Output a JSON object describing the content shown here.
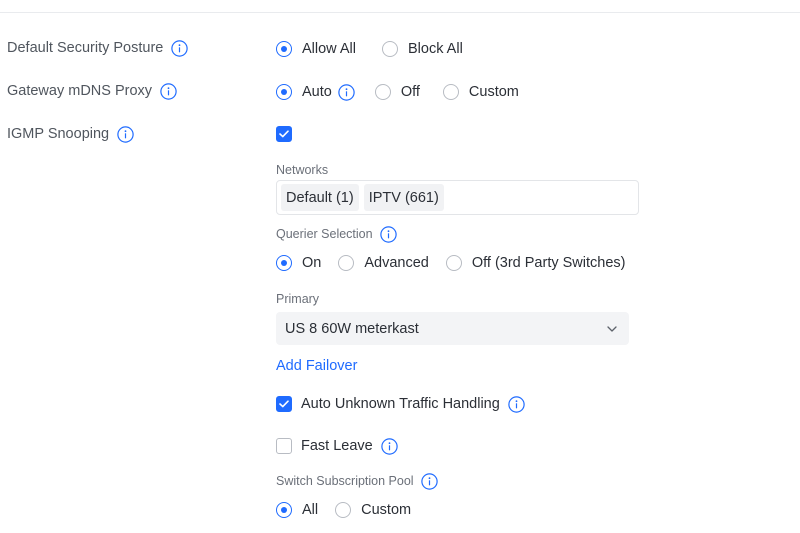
{
  "security_posture": {
    "label": "Default Security Posture",
    "options": [
      {
        "label": "Allow All",
        "selected": true
      },
      {
        "label": "Block All",
        "selected": false
      }
    ]
  },
  "mdns_proxy": {
    "label": "Gateway mDNS Proxy",
    "options": [
      {
        "label": "Auto",
        "selected": true
      },
      {
        "label": "Off",
        "selected": false
      },
      {
        "label": "Custom",
        "selected": false
      }
    ]
  },
  "igmp": {
    "label": "IGMP Snooping",
    "enabled": true,
    "networks_label": "Networks",
    "networks": [
      "Default (1)",
      "IPTV (661)"
    ],
    "querier_label": "Querier Selection",
    "querier_options": [
      {
        "label": "On",
        "selected": true
      },
      {
        "label": "Advanced",
        "selected": false
      },
      {
        "label": "Off (3rd Party Switches)",
        "selected": false
      }
    ],
    "primary_label": "Primary",
    "primary_value": "US 8 60W meterkast",
    "add_failover": "Add Failover",
    "auto_unknown": {
      "label": "Auto Unknown Traffic Handling",
      "checked": true
    },
    "fast_leave": {
      "label": "Fast Leave",
      "checked": false
    },
    "pool_label": "Switch Subscription Pool",
    "pool_options": [
      {
        "label": "All",
        "selected": true
      },
      {
        "label": "Custom",
        "selected": false
      }
    ]
  },
  "colors": {
    "accent": "#1f6bff",
    "label_text": "#50565e",
    "body_text": "#2b2f36",
    "border": "#b8bcc3"
  }
}
